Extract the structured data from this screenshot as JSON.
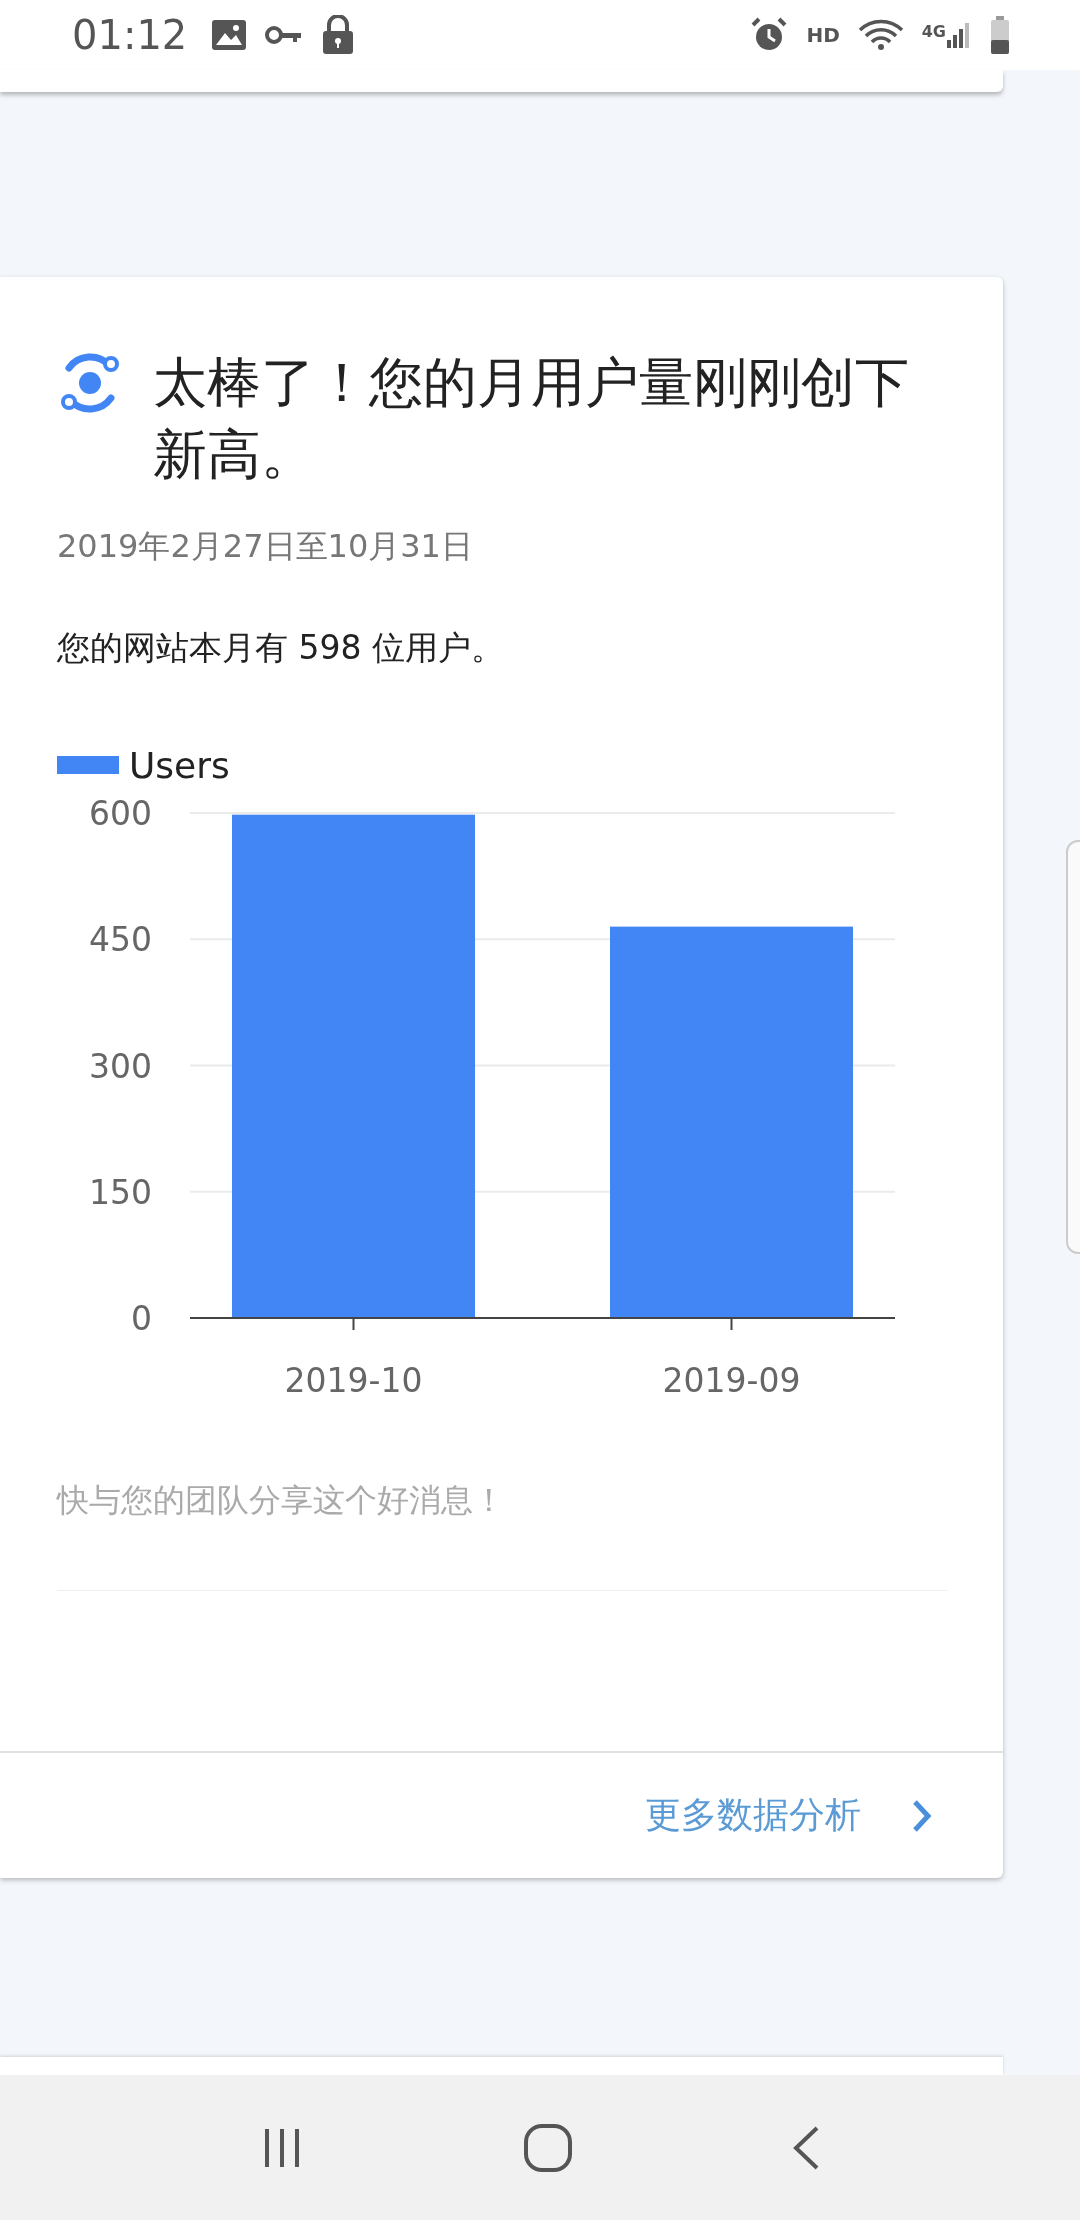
{
  "status_bar": {
    "time": "01:12",
    "hd_label": "HD",
    "network_label": "4G"
  },
  "card": {
    "title": "太棒了！您的月用户量刚刚创下新高。",
    "date_range": "2019年2月27日至10月31日",
    "summary": "您的网站本月有 598 位用户。",
    "chart_data": {
      "type": "bar",
      "categories": [
        "2019-10",
        "2019-09"
      ],
      "series": [
        {
          "name": "Users",
          "color": "#4285f4",
          "values": [
            598,
            465
          ]
        }
      ],
      "ylim": [
        0,
        600
      ],
      "yticks": [
        0,
        150,
        300,
        450,
        600
      ],
      "grid": true
    },
    "share_note": "快与您的团队分享这个好消息！",
    "link": "更多数据分析"
  }
}
